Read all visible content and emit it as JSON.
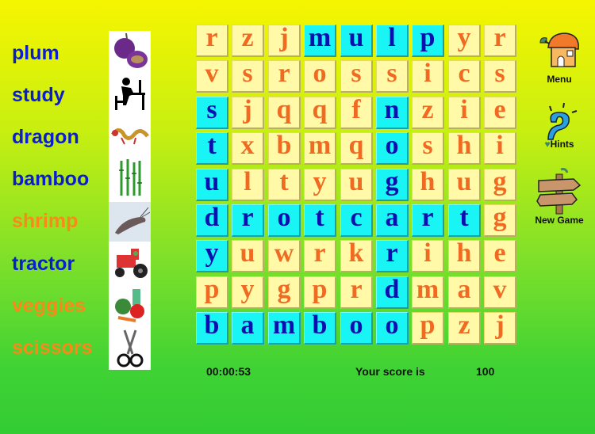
{
  "words": [
    {
      "text": "plum",
      "found": true,
      "picture": "plum-icon"
    },
    {
      "text": "study",
      "found": true,
      "picture": "study-icon"
    },
    {
      "text": "dragon",
      "found": true,
      "picture": "dragon-icon"
    },
    {
      "text": "bamboo",
      "found": true,
      "picture": "bamboo-icon"
    },
    {
      "text": "shrimp",
      "found": false,
      "picture": "shrimp-icon"
    },
    {
      "text": "tractor",
      "found": true,
      "picture": "tractor-icon"
    },
    {
      "text": "veggies",
      "found": false,
      "picture": "veggies-icon"
    },
    {
      "text": "scissors",
      "found": false,
      "picture": "scissors-icon"
    }
  ],
  "grid": [
    [
      "r",
      "z",
      "j",
      "m",
      "u",
      "l",
      "p",
      "y",
      "r"
    ],
    [
      "v",
      "s",
      "r",
      "o",
      "s",
      "s",
      "i",
      "c",
      "s"
    ],
    [
      "s",
      "j",
      "q",
      "q",
      "f",
      "n",
      "z",
      "i",
      "e"
    ],
    [
      "t",
      "x",
      "b",
      "m",
      "q",
      "o",
      "s",
      "h",
      "i"
    ],
    [
      "u",
      "l",
      "t",
      "y",
      "u",
      "g",
      "h",
      "u",
      "g"
    ],
    [
      "d",
      "r",
      "o",
      "t",
      "c",
      "a",
      "r",
      "t",
      "g"
    ],
    [
      "y",
      "u",
      "w",
      "r",
      "k",
      "r",
      "i",
      "h",
      "e"
    ],
    [
      "p",
      "y",
      "g",
      "p",
      "r",
      "d",
      "m",
      "a",
      "v"
    ],
    [
      "b",
      "a",
      "m",
      "b",
      "o",
      "o",
      "p",
      "z",
      "j"
    ]
  ],
  "highlighted": [
    [
      0,
      0,
      0,
      1,
      1,
      1,
      1,
      0,
      0
    ],
    [
      0,
      0,
      0,
      0,
      0,
      0,
      0,
      0,
      0
    ],
    [
      1,
      0,
      0,
      0,
      0,
      1,
      0,
      0,
      0
    ],
    [
      1,
      0,
      0,
      0,
      0,
      1,
      0,
      0,
      0
    ],
    [
      1,
      0,
      0,
      0,
      0,
      1,
      0,
      0,
      0
    ],
    [
      1,
      1,
      1,
      1,
      1,
      1,
      1,
      1,
      0
    ],
    [
      1,
      0,
      0,
      0,
      0,
      1,
      0,
      0,
      0
    ],
    [
      0,
      0,
      0,
      0,
      0,
      1,
      0,
      0,
      0
    ],
    [
      1,
      1,
      1,
      1,
      1,
      1,
      0,
      0,
      0
    ]
  ],
  "buttons": {
    "menu": {
      "label": "Menu",
      "icon": "mushroom-house-icon"
    },
    "hints": {
      "label": "Hints",
      "icon": "question-mark-icon"
    },
    "new_game": {
      "label": "New Game",
      "icon": "signpost-icon"
    }
  },
  "status": {
    "timer": "00:00:53",
    "score_label": "Your score is",
    "score": "100"
  },
  "colors": {
    "found_word": "#0a1ecf",
    "pending_word": "#f98a1a",
    "tile": "#fff9a8",
    "tile_letter": "#f06a22",
    "highlight_tile": "#19f5f5",
    "highlight_letter": "#0a10b0"
  }
}
